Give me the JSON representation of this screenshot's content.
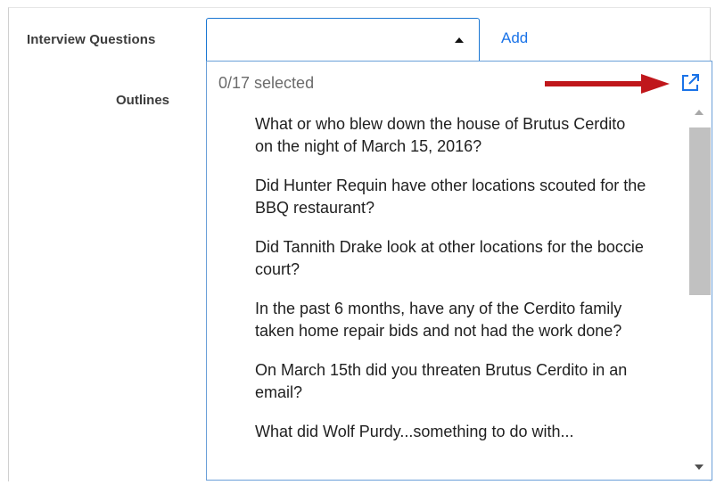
{
  "form": {
    "interview_label": "Interview Questions",
    "outlines_label": "Outlines",
    "add_label": "Add",
    "select_value": ""
  },
  "dropdown": {
    "selected_count": "0/17 selected",
    "questions": [
      "What or who blew down the house of Brutus Cerdito on the night of March 15, 2016?",
      "Did Hunter Requin have other locations scouted for the BBQ restaurant?",
      "Did Tannith Drake look at other locations for the boccie court?",
      "In the past 6 months, have any of the Cerdito family taken home repair bids and not had the work done?",
      "On March 15th did you threaten Brutus Cerdito in an email?",
      "What did Wolf Purdy...something to do with..."
    ]
  },
  "colors": {
    "accent": "#1976d2",
    "link": "#1a73e8",
    "annotation_arrow": "#c0171b"
  },
  "icons": {
    "popout": "open-in-new-icon",
    "caret": "caret-up-icon"
  }
}
